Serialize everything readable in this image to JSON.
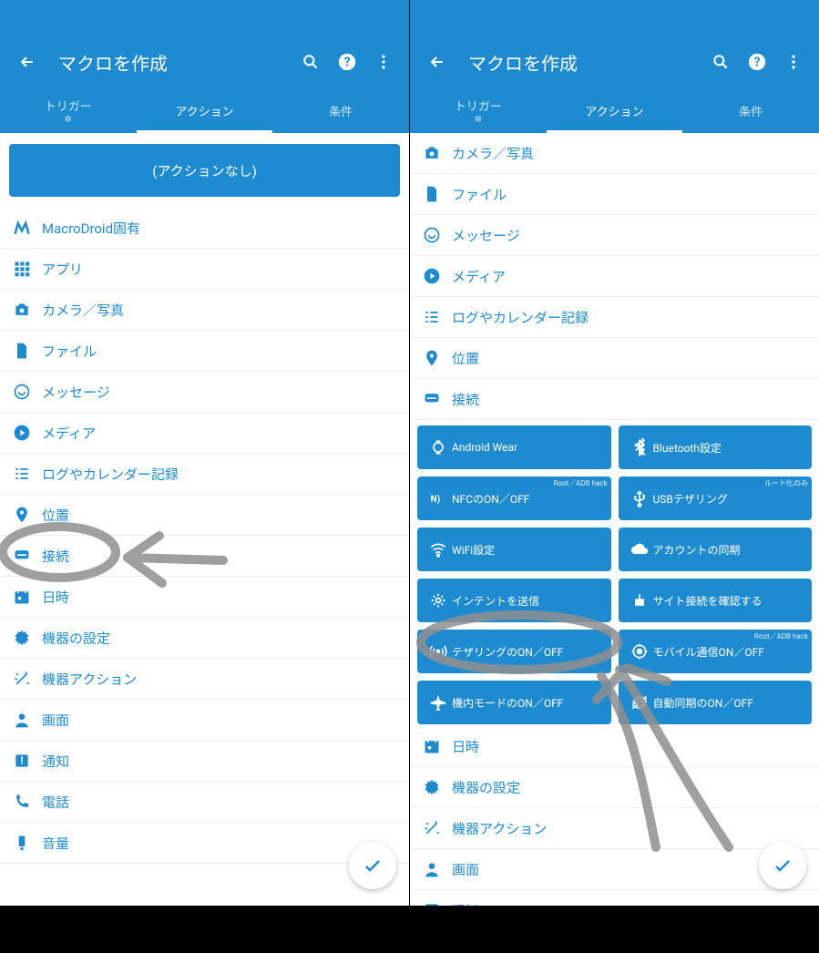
{
  "colors": {
    "primary": "#1e8bd1",
    "annotation": "#8f8f8f"
  },
  "header": {
    "title": "マクロを作成"
  },
  "tabs": {
    "trigger": "トリガー",
    "trigger_sub": "✲",
    "action": "アクション",
    "condition": "条件"
  },
  "no_action": "(アクションなし)",
  "left_categories": [
    "MacroDroid固有",
    "アプリ",
    "カメラ／写真",
    "ファイル",
    "メッセージ",
    "メディア",
    "ログやカレンダー記録",
    "位置",
    "接続",
    "日時",
    "機器の設定",
    "機器アクション",
    "画面",
    "通知",
    "電話",
    "音量"
  ],
  "right_top_categories": [
    "カメラ／写真",
    "ファイル",
    "メッセージ",
    "メディア",
    "ログやカレンダー記録",
    "位置",
    "接続"
  ],
  "connection_actions": [
    {
      "label": "Android Wear",
      "badge": ""
    },
    {
      "label": "Bluetooth設定",
      "badge": ""
    },
    {
      "label": "NFCのON／OFF",
      "badge": "Root／ADB hack"
    },
    {
      "label": "USBテザリング",
      "badge": "ルート化のみ"
    },
    {
      "label": "WiFi設定",
      "badge": ""
    },
    {
      "label": "アカウントの同期",
      "badge": ""
    },
    {
      "label": "インテントを送信",
      "badge": ""
    },
    {
      "label": "サイト接続を確認する",
      "badge": ""
    },
    {
      "label": "テザリングのON／OFF",
      "badge": ""
    },
    {
      "label": "モバイル通信ON／OFF",
      "badge": "Root／ADB hack"
    },
    {
      "label": "機内モードのON／OFF",
      "badge": ""
    },
    {
      "label": "自動同期のON／OFF",
      "badge": ""
    }
  ],
  "right_bottom_categories": [
    "日時",
    "機器の設定",
    "機器アクション",
    "画面",
    "通知"
  ]
}
